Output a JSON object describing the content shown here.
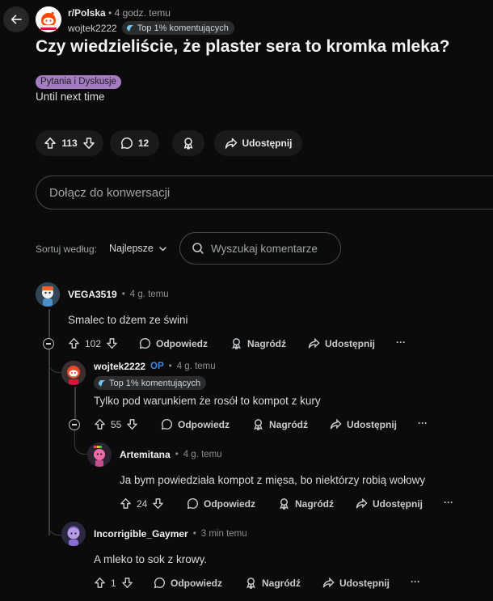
{
  "post": {
    "subreddit": "r/Polska",
    "time": "4 godz. temu",
    "author": "wojtek2222",
    "author_badge": "Top 1% komentujących",
    "title": "Czy wiedzieliście, że plaster sera to kromka mleka?",
    "flair": "Pytania i Dyskusje",
    "body": "Until next time",
    "votes": "113",
    "comments": "12",
    "share_label": "Udostępnij"
  },
  "join": {
    "placeholder": "Dołącz do konwersacji"
  },
  "sort": {
    "label": "Sortuj według:",
    "value": "Najlepsze"
  },
  "search": {
    "placeholder": "Wyszukaj komentarze"
  },
  "labels": {
    "reply": "Odpowiedz",
    "award": "Nagródź",
    "share": "Udostępnij",
    "op": "OP",
    "more": "···"
  },
  "comments": [
    {
      "author": "VEGA3519",
      "time": "4 g. temu",
      "text": "Smalec to dżem ze świni",
      "votes": "102"
    },
    {
      "author": "wojtek2222",
      "time": "4 g. temu",
      "badge": "Top 1% komentujących",
      "text": "Tylko pod warunkiem że rosół to kompot z kury",
      "votes": "55"
    },
    {
      "author": "Artemitana",
      "time": "4 g. temu",
      "text": "Ja bym powiedziała kompot z mięsa, bo niektórzy robią wołowy",
      "votes": "24"
    },
    {
      "author": "Incorrigible_Gaymer",
      "time": "3 min temu",
      "text": "A mleko to sok z krowy.",
      "votes": "1"
    }
  ],
  "colors": {
    "background": "#0b0b0b",
    "pill": "#1a1a1b",
    "flair": "#a57bc2",
    "op_blue": "#3f86e0"
  }
}
